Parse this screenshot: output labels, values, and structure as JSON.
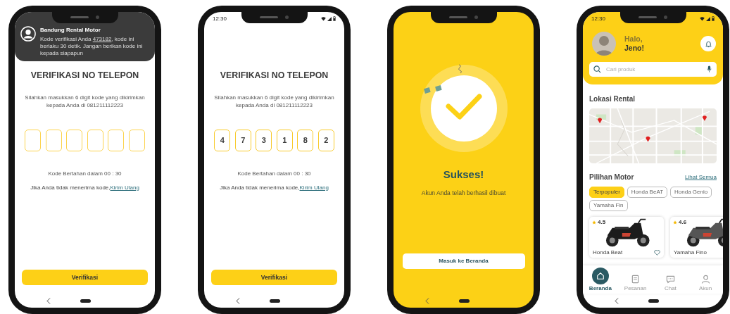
{
  "screens": [
    {
      "kind": "verification",
      "notification": {
        "app": "Bandung Rental Motor",
        "message": "Kode verifikasi Anda ",
        "code": "473182",
        "message_end": ", kode ini berlaku 30 detik. Jangan berikan kode ini kepada siapapun"
      },
      "title": "VERIFIKASI NO TELEPON",
      "instruction": "Silahkan masukkan 6 digit kode yang dikirimkan kepada Anda di 081211112223",
      "otp": [
        {
          "filled": false
        },
        {
          "filled": false
        },
        {
          "filled": false
        },
        {
          "filled": false
        },
        {
          "filled": false
        },
        {
          "filled": false
        }
      ],
      "timer": "Kode Bertahan dalam 00 : 30",
      "resend_text": "Jika Anda tidak menerima kode,",
      "resend_link": "Kirim Ulang",
      "button": "Verifikasi"
    },
    {
      "kind": "verification",
      "status_bar": {
        "time": "12:30"
      },
      "title": "VERIFIKASI NO TELEPON",
      "instruction": "Silahkan masukkan 6 digit kode yang dikirimkan kepada Anda di 081211112223",
      "otp": [
        {
          "filled": true,
          "digit": "4"
        },
        {
          "filled": true,
          "digit": "7"
        },
        {
          "filled": true,
          "digit": "3"
        },
        {
          "filled": true,
          "digit": "1"
        },
        {
          "filled": true,
          "digit": "8"
        },
        {
          "filled": true,
          "digit": "2"
        }
      ],
      "timer": "Kode Bertahan dalam 00 : 30",
      "resend_text": "Jika Anda tidak menerima kode,",
      "resend_link": "Kirim Ulang",
      "button": "Verifikasi"
    },
    {
      "kind": "success",
      "title": "Sukses!",
      "message": "Akun Anda telah berhasil dibuat",
      "button": "Masuk ke Beranda"
    },
    {
      "kind": "home",
      "status_bar": {
        "time": "12:30"
      },
      "greeting": "Halo,",
      "user_name": "Jeno!",
      "search": {
        "placeholder": "Cari produk"
      },
      "location_title": "Lokasi Rental",
      "motor_title": "Pilihan Motor",
      "see_all": "Lihat Semua",
      "chips": [
        {
          "label": "Terpopuler",
          "selected": true
        },
        {
          "label": "Honda BeAT",
          "selected": false
        },
        {
          "label": "Honda Genio",
          "selected": false
        },
        {
          "label": "Yamaha Fin",
          "selected": false
        }
      ],
      "cards": [
        {
          "rating": "4.5",
          "name": "Honda Beat",
          "liked": false
        },
        {
          "rating": "4.6",
          "name": "Yamaha Fino"
        }
      ],
      "bottom_nav": [
        {
          "label": "Beranda",
          "selected": true
        },
        {
          "label": "Pesanan",
          "selected": false
        },
        {
          "label": "Chat",
          "selected": false
        },
        {
          "label": "Akun",
          "selected": false
        }
      ]
    }
  ]
}
